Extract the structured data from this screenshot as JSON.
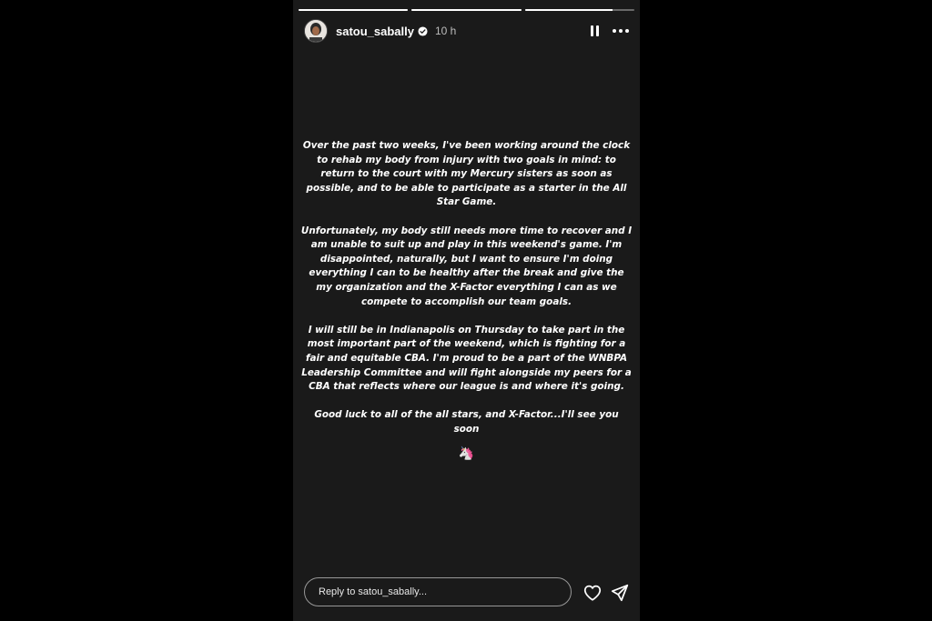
{
  "story": {
    "progress": [
      {
        "value": 1.0
      },
      {
        "value": 1.0
      },
      {
        "value": 0.8
      }
    ],
    "header": {
      "username": "satou_sabally",
      "time": "10 h",
      "verified": true
    },
    "paragraphs": [
      "Over the past two weeks, I've been working around the clock to rehab my body from injury with two goals in mind: to return to the court with my Mercury sisters as soon as possible, and to be able to participate as a starter in the All Star Game.",
      "Unfortunately, my body still needs more time to recover and I am unable to suit up and play in this weekend's game. I'm disappointed, naturally, but I want to ensure I'm doing everything I can to be healthy after the break and give the my organization and the X-Factor everything I can as we compete to accomplish our team goals.",
      "I will still be in Indianapolis on Thursday to take part in the most important part of the weekend, which is fighting for a fair and equitable CBA. I'm proud to be a part of the WNBPA Leadership Committee and will fight alongside my peers for a CBA that reflects where our league is and where it's going.",
      "Good luck to all of the all stars, and X-Factor...I'll see you soon"
    ],
    "emoji": "🦄",
    "reply": {
      "placeholder": "Reply to satou_sabally..."
    },
    "icons": {
      "pause": "pause-icon",
      "more": "more-icon",
      "like": "heart-icon",
      "send": "send-icon",
      "verified": "verified-badge-icon"
    }
  }
}
